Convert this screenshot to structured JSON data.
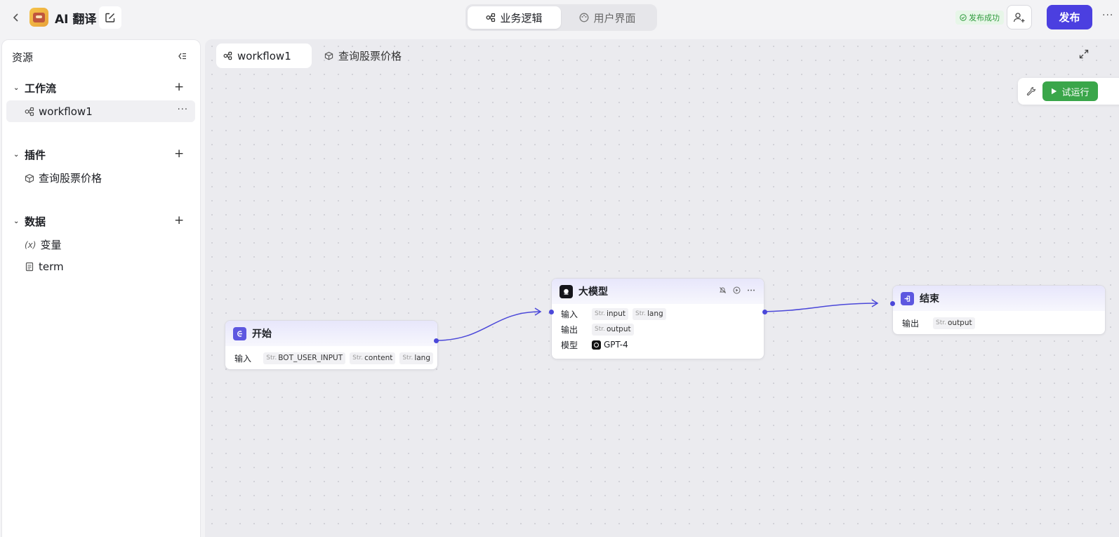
{
  "app": {
    "title": "AI 翻译"
  },
  "mode_tabs": [
    {
      "label": "业务逻辑"
    },
    {
      "label": "用户界面"
    }
  ],
  "status": "发布成功",
  "publish_label": "发布",
  "sidebar": {
    "header": "资源",
    "groups": [
      {
        "title": "工作流",
        "items": [
          {
            "label": "workflow1"
          }
        ]
      },
      {
        "title": "插件",
        "items": [
          {
            "label": "查询股票价格"
          }
        ]
      },
      {
        "title": "数据",
        "items": [
          {
            "label": "变量"
          },
          {
            "label": "term"
          }
        ]
      }
    ]
  },
  "canvas": {
    "tabs": [
      {
        "label": "workflow1"
      },
      {
        "label": "查询股票价格"
      }
    ],
    "run_label": "试运行",
    "str_prefix": "Str.",
    "nodes": {
      "start": {
        "title": "开始",
        "input_label": "输入",
        "params": [
          "BOT_USER_INPUT",
          "content",
          "lang"
        ]
      },
      "llm": {
        "title": "大模型",
        "input_label": "输入",
        "inputs": [
          "input",
          "lang"
        ],
        "output_label": "输出",
        "outputs": [
          "output"
        ],
        "model_label": "模型",
        "model": "GPT-4"
      },
      "end": {
        "title": "结束",
        "output_label": "输出",
        "outputs": [
          "output"
        ]
      }
    }
  },
  "colors": {
    "accent": "#4b3fe0",
    "run_green": "#3aa64a",
    "edge": "#4b48d9",
    "success": "#2e9a3c"
  }
}
